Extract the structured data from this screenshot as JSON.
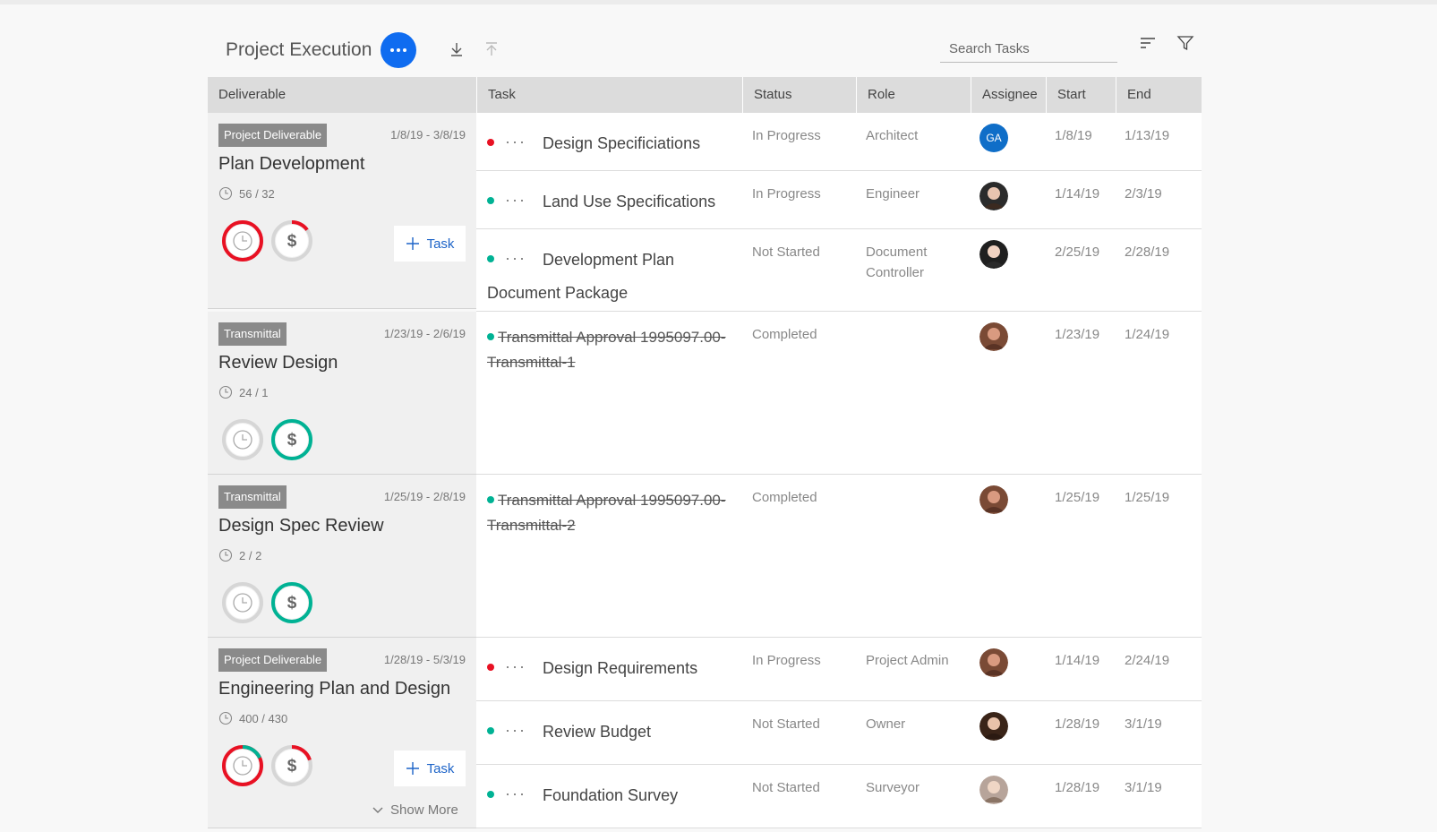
{
  "toolbar": {
    "title": "Project Execution",
    "search_placeholder": "Search Tasks",
    "icons": [
      "more-icon",
      "download-icon",
      "upload-icon",
      "sort-icon",
      "filter-icon"
    ],
    "accent": "#0f6cf0"
  },
  "columns": [
    "Deliverable",
    "Task",
    "Status",
    "Role",
    "Assignee",
    "Start",
    "End"
  ],
  "deliverables": [
    {
      "badge": "Project Deliverable",
      "dates": "1/8/19 - 3/8/19",
      "title": "Plan Development",
      "hours": "56 / 32",
      "has_task_button": true,
      "task_button_label": "Task",
      "tasks": [
        {
          "name": "Design Specificiations",
          "status": "In Progress",
          "role": "Architect",
          "assignee": "GA",
          "start": "1/8/19",
          "end": "1/13/19",
          "dot": "#e81123",
          "done": false
        },
        {
          "name": "Land Use Specifications",
          "status": "In Progress",
          "role": "Engineer",
          "assignee": "",
          "start": "1/14/19",
          "end": "2/3/19",
          "dot": "#00b294",
          "done": false
        },
        {
          "name": "Development Plan Document Package",
          "status": "Not Started",
          "role": "Document Controller",
          "assignee": "",
          "start": "2/25/19",
          "end": "2/28/19",
          "dot": "#00b294",
          "done": false
        }
      ]
    },
    {
      "badge": "Transmittal",
      "dates": "1/23/19 - 2/6/19",
      "title": "Review Design",
      "hours": "24 / 1",
      "has_task_button": false,
      "tasks": [
        {
          "name": "Transmittal Approval 1995097.00-Transmittal-1",
          "status": "Completed",
          "role": "",
          "assignee": "",
          "start": "1/23/19",
          "end": "1/24/19",
          "dot": "#00b294",
          "done": true
        }
      ]
    },
    {
      "badge": "Transmittal",
      "dates": "1/25/19 - 2/8/19",
      "title": "Design Spec Review",
      "hours": "2 / 2",
      "has_task_button": false,
      "tasks": [
        {
          "name": "Transmittal Approval 1995097.00-Transmittal-2",
          "status": "Completed",
          "role": "",
          "assignee": "",
          "start": "1/25/19",
          "end": "1/25/19",
          "dot": "#00b294",
          "done": true
        }
      ]
    },
    {
      "badge": "Project Deliverable",
      "dates": "1/28/19 - 5/3/19",
      "title": "Engineering Plan and Design",
      "hours": "400 / 430",
      "has_task_button": true,
      "task_button_label": "Task",
      "show_more": "Show More",
      "tasks": [
        {
          "name": "Design Requirements",
          "status": "In Progress",
          "role": "Project Admin",
          "assignee": "",
          "start": "1/14/19",
          "end": "2/24/19",
          "dot": "#e81123",
          "done": false
        },
        {
          "name": "Review Budget",
          "status": "Not Started",
          "role": "Owner",
          "assignee": "",
          "start": "1/28/19",
          "end": "3/1/19",
          "dot": "#00b294",
          "done": false
        },
        {
          "name": "Foundation Survey",
          "status": "Not Started",
          "role": "Surveyor",
          "assignee": "",
          "start": "1/28/19",
          "end": "3/1/19",
          "dot": "#00b294",
          "done": false
        }
      ]
    }
  ],
  "colors": {
    "red": "#e81123",
    "teal": "#00b294",
    "grey": "#d6d6d6"
  }
}
